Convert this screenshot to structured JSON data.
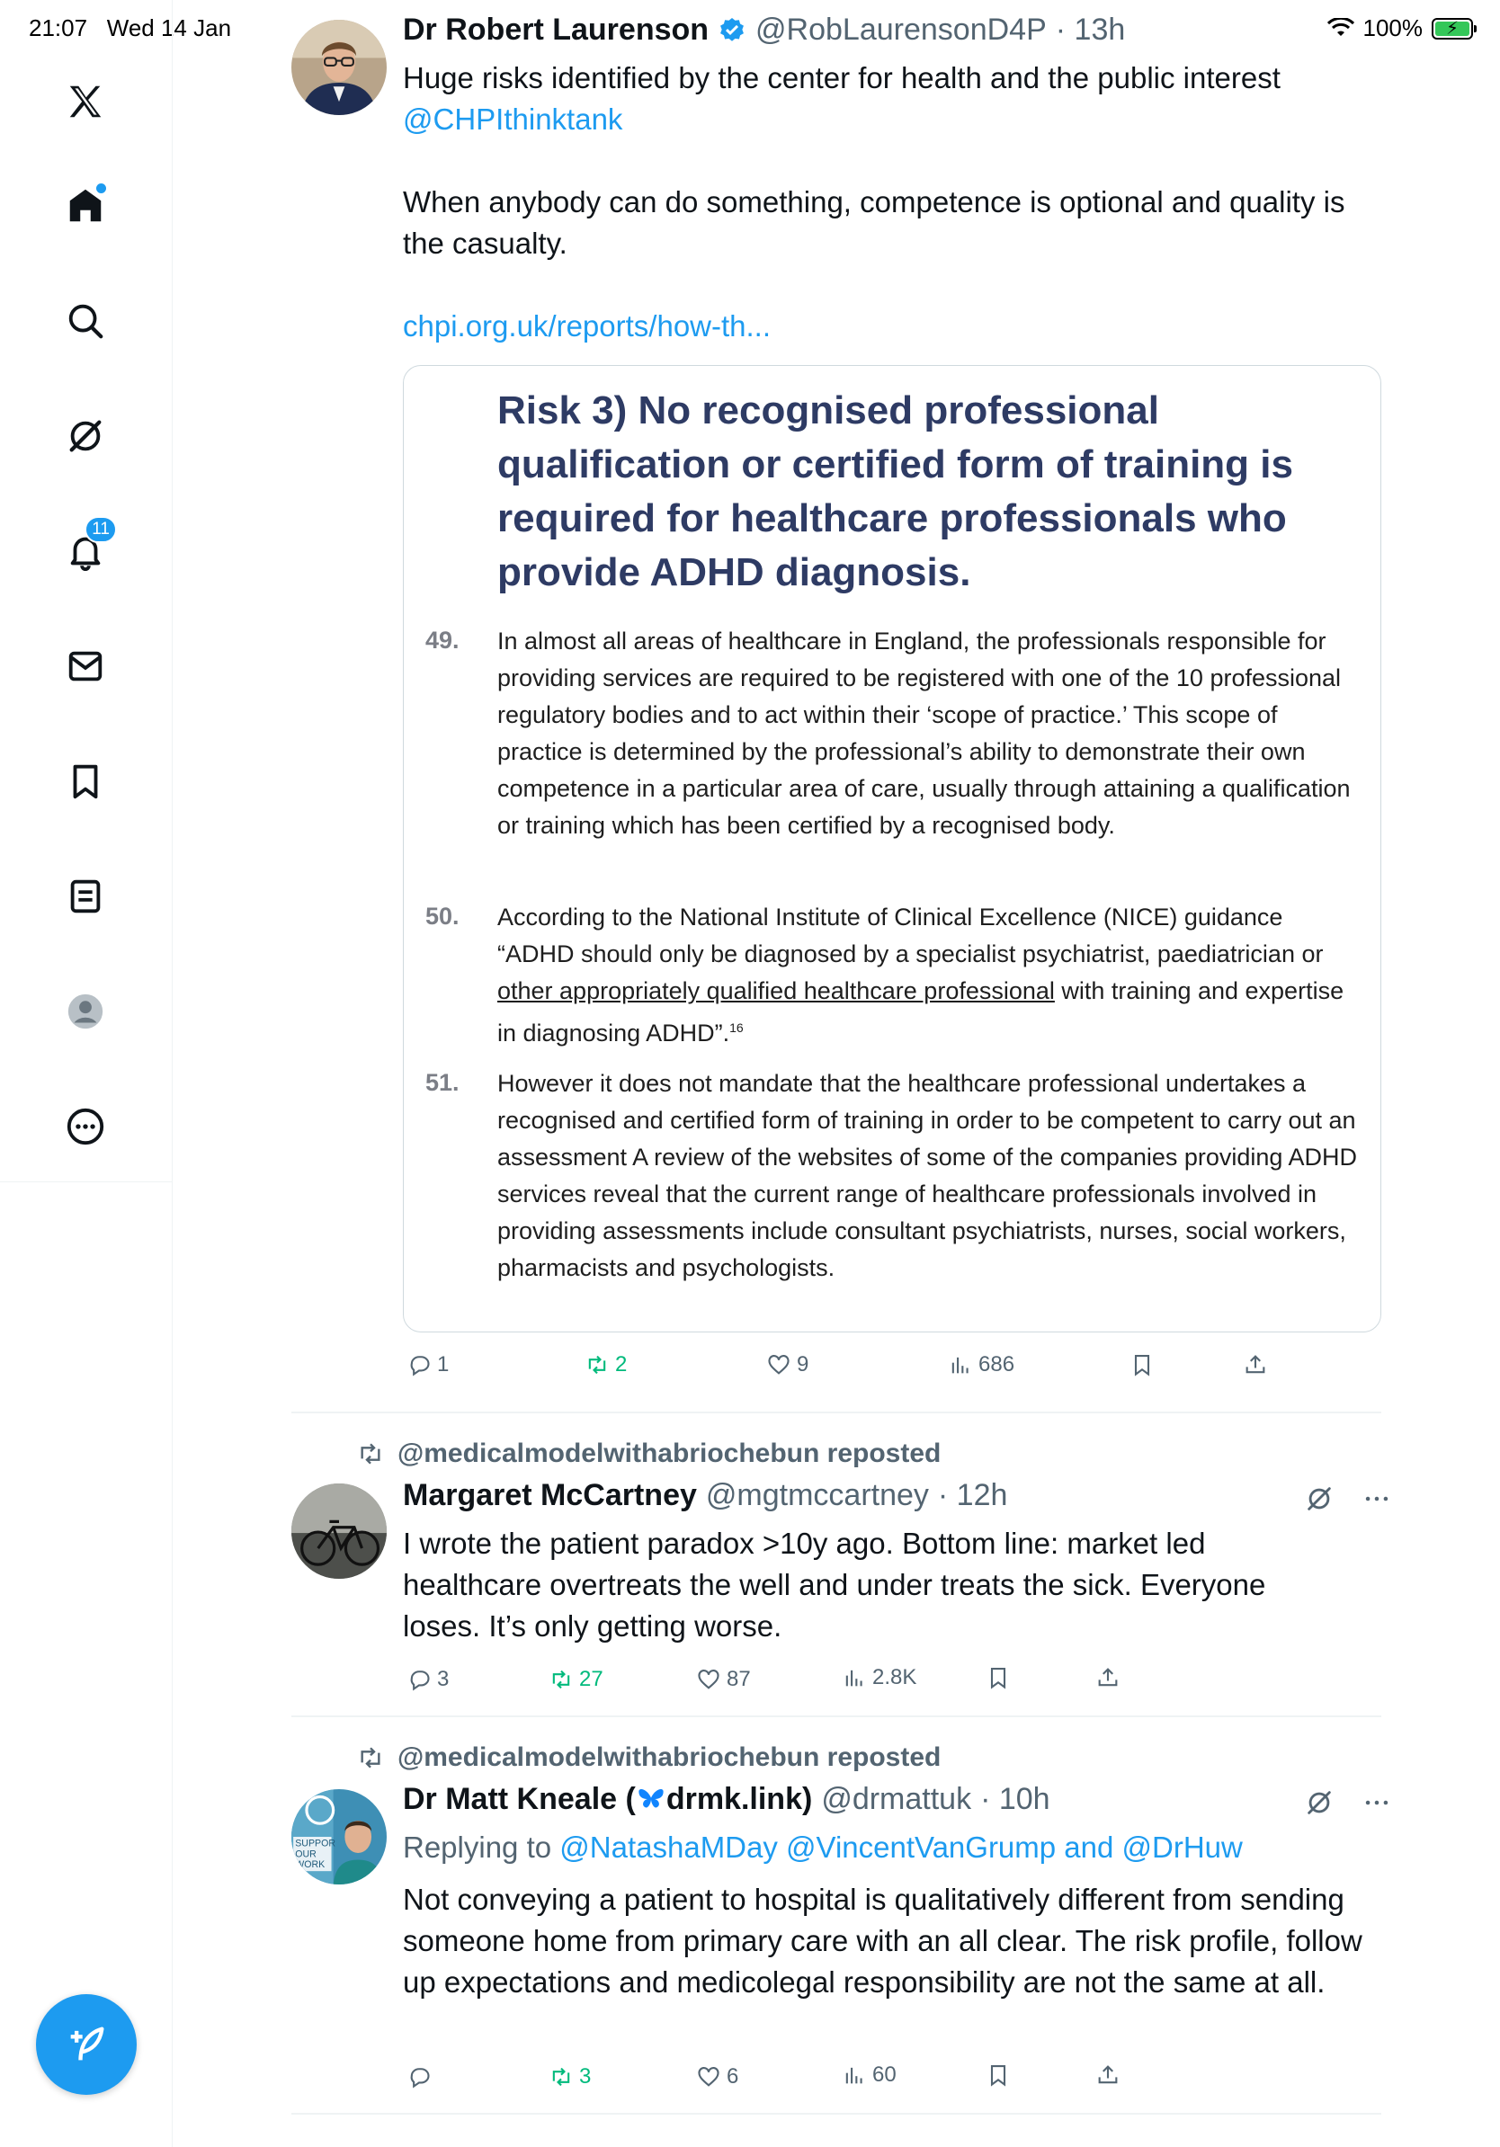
{
  "status_bar": {
    "time": "21:07",
    "date": "Wed 14 Jan",
    "battery": "100%"
  },
  "sidebar": {
    "items": [
      {
        "name": "x-logo-icon"
      },
      {
        "name": "home-icon"
      },
      {
        "name": "search-icon"
      },
      {
        "name": "grok-icon"
      },
      {
        "name": "notifications-icon",
        "badge": "11"
      },
      {
        "name": "messages-icon"
      },
      {
        "name": "bookmarks-icon"
      },
      {
        "name": "lists-icon"
      },
      {
        "name": "profile-icon"
      },
      {
        "name": "more-icon"
      }
    ],
    "notification_badge": "11"
  },
  "colors": {
    "accent": "#1d9bf0",
    "retweet_green": "#00ba7c",
    "secondary_text": "#536471"
  },
  "posts": [
    {
      "author": "Dr Robert Laurenson",
      "handle": "@RobLaurensonD4P",
      "time": "· 13h",
      "verified": true,
      "text_1": "Huge risks identified by the center for health and the public interest",
      "mention": "@CHPIthinktank",
      "text_2": "When anybody can do something, competence is optional and quality is the casualty.",
      "link": "chpi.org.uk/reports/how-th...",
      "document": {
        "heading": "Risk 3) No recognised professional qualification or certified form of training is required for healthcare professionals who provide ADHD diagnosis.",
        "paragraphs": [
          {
            "number": "49.",
            "text": "In almost all areas of healthcare in England, the professionals responsible for providing services are required to be registered with one of the 10 professional regulatory bodies and to act within their ‘scope of practice.’ This scope of practice is determined by the professional’s ability to demonstrate their own competence in a particular area of care, usually through attaining a qualification or training which has been certified by a recognised body."
          },
          {
            "number": "50.",
            "text_before": "According to the National Institute of Clinical Excellence (NICE) guidance “ADHD should only be diagnosed by a specialist psychiatrist, paediatrician or ",
            "text_underlined": "other appropriately qualified healthcare professional",
            "text_after": " with training and expertise in diagnosing ADHD”.",
            "footnote": "16"
          },
          {
            "number": "51.",
            "text": "However it does not mandate that the healthcare professional undertakes a recognised and certified form of training in order to be competent to carry out an assessment A review of the websites of some of the companies providing ADHD services reveal that the current range of healthcare professionals involved in providing assessments include consultant psychiatrists, nurses, social workers, pharmacists and psychologists."
          }
        ]
      },
      "stats": {
        "replies": "1",
        "reposts": "2",
        "likes": "9",
        "views": "686"
      }
    },
    {
      "reposted_by": "@medicalmodelwithabriochebun reposted",
      "author": "Margaret McCartney",
      "handle": "@mgtmccartney",
      "time": "· 12h",
      "text": "I wrote the patient paradox >10y ago. Bottom line: market led healthcare overtreats the well and under treats the sick. Everyone loses. It’s only getting worse.",
      "stats": {
        "replies": "3",
        "reposts": "27",
        "likes": "87",
        "views": "2.8K"
      }
    },
    {
      "reposted_by": "@medicalmodelwithabriochebun reposted",
      "author_1": "Dr Matt Kneale (",
      "author_2": "drmk.link)",
      "handle": "@drmattuk",
      "time": "· 10h",
      "replying_prefix": "Replying to",
      "replying_to": "@NatashaMDay @VincentVanGrump and @DrHuw",
      "text": "Not conveying a patient to hospital is qualitatively different from sending someone home from primary care with an all clear. The risk profile, follow up expectations and medicolegal responsibility are not the same at all.",
      "avatar_text": "SUPPOR OUR WORK",
      "stats": {
        "replies": "",
        "reposts": "3",
        "likes": "6",
        "views": "60"
      }
    }
  ]
}
